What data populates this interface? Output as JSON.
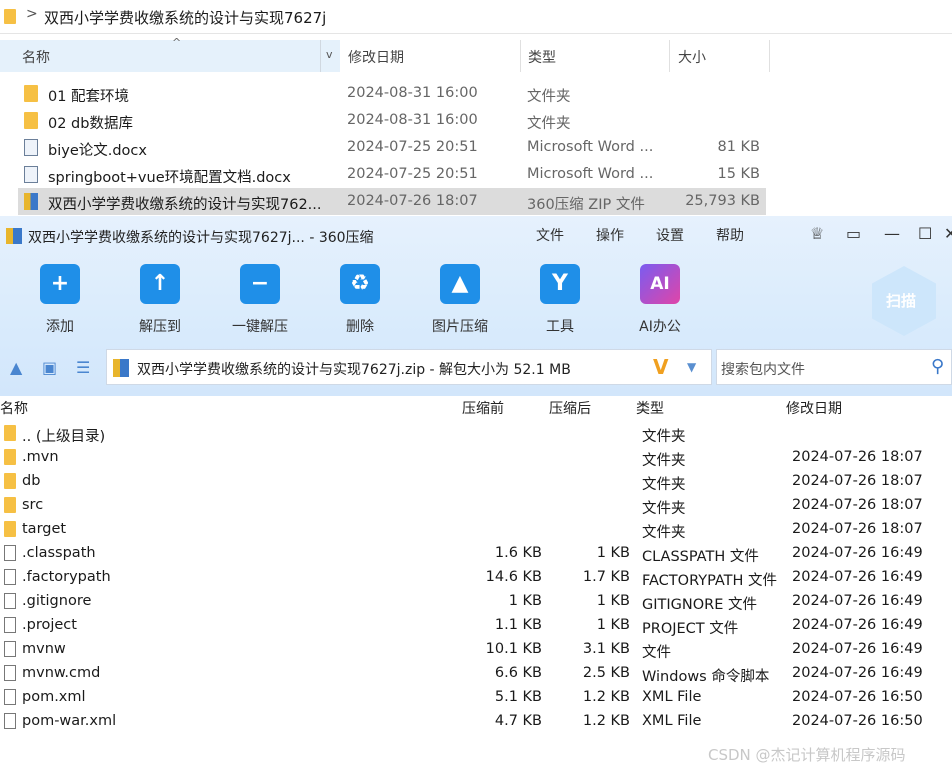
{
  "explorer": {
    "breadcrumb_sep": ">",
    "path": "双西小学学费收缴系统的设计与实现7627j",
    "columns": {
      "name": "名称",
      "date": "修改日期",
      "type": "类型",
      "size": "大小"
    },
    "rows": [
      {
        "name": "01 配套环境",
        "date": "2024-08-31 16:00",
        "type": "文件夹",
        "size": "",
        "icon": "folder-icon"
      },
      {
        "name": "02 db数据库",
        "date": "2024-08-31 16:00",
        "type": "文件夹",
        "size": "",
        "icon": "folder-icon"
      },
      {
        "name": "biye论文.docx",
        "date": "2024-07-25 20:51",
        "type": "Microsoft Word ...",
        "size": "81 KB",
        "icon": "word-doc-icon"
      },
      {
        "name": "springboot+vue环境配置文档.docx",
        "date": "2024-07-25 20:51",
        "type": "Microsoft Word ...",
        "size": "15 KB",
        "icon": "word-doc-icon"
      },
      {
        "name": "双西小学学费收缴系统的设计与实现762...",
        "date": "2024-07-26 18:07",
        "type": "360压缩 ZIP 文件",
        "size": "25,793 KB",
        "icon": "zip-icon",
        "selected": true
      }
    ]
  },
  "zip": {
    "title": "双西小学学费收缴系统的设计与实现7627j... - 360压缩",
    "menu": [
      "文件",
      "操作",
      "设置",
      "帮助"
    ],
    "tools": [
      {
        "label": "添加",
        "icon": "add-icon",
        "glyph": "+"
      },
      {
        "label": "解压到",
        "icon": "extract-to-icon",
        "glyph": "↑"
      },
      {
        "label": "一键解压",
        "icon": "one-click-extract-icon",
        "glyph": "−"
      },
      {
        "label": "删除",
        "icon": "delete-icon",
        "glyph": "♻"
      },
      {
        "label": "图片压缩",
        "icon": "image-compress-icon",
        "glyph": "▲"
      },
      {
        "label": "工具",
        "icon": "tools-icon",
        "glyph": "Y"
      },
      {
        "label": "AI办公",
        "icon": "ai-office-icon",
        "glyph": "AI"
      }
    ],
    "scan_label": "扫描",
    "path_text": "双西小学学费收缴系统的设计与实现7627j.zip - 解包大小为 52.1 MB",
    "search_placeholder": "搜索包内文件",
    "columns": {
      "name": "名称",
      "compressed_before": "压缩前",
      "compressed_after": "压缩后",
      "type": "类型",
      "date": "修改日期"
    },
    "rows": [
      {
        "name": ".. (上级目录)",
        "before": "",
        "after": "",
        "type": "文件夹",
        "date": "",
        "icon": "folder"
      },
      {
        "name": ".mvn",
        "before": "",
        "after": "",
        "type": "文件夹",
        "date": "2024-07-26 18:07",
        "icon": "folder"
      },
      {
        "name": "db",
        "before": "",
        "after": "",
        "type": "文件夹",
        "date": "2024-07-26 18:07",
        "icon": "folder"
      },
      {
        "name": "src",
        "before": "",
        "after": "",
        "type": "文件夹",
        "date": "2024-07-26 18:07",
        "icon": "folder"
      },
      {
        "name": "target",
        "before": "",
        "after": "",
        "type": "文件夹",
        "date": "2024-07-26 18:07",
        "icon": "folder"
      },
      {
        "name": ".classpath",
        "before": "1.6 KB",
        "after": "1 KB",
        "type": "CLASSPATH 文件",
        "date": "2024-07-26 16:49",
        "icon": "file"
      },
      {
        "name": ".factorypath",
        "before": "14.6 KB",
        "after": "1.7 KB",
        "type": "FACTORYPATH 文件",
        "date": "2024-07-26 16:49",
        "icon": "file"
      },
      {
        "name": ".gitignore",
        "before": "1 KB",
        "after": "1 KB",
        "type": "GITIGNORE 文件",
        "date": "2024-07-26 16:49",
        "icon": "file"
      },
      {
        "name": ".project",
        "before": "1.1 KB",
        "after": "1 KB",
        "type": "PROJECT 文件",
        "date": "2024-07-26 16:49",
        "icon": "file"
      },
      {
        "name": "mvnw",
        "before": "10.1 KB",
        "after": "3.1 KB",
        "type": "文件",
        "date": "2024-07-26 16:49",
        "icon": "file"
      },
      {
        "name": "mvnw.cmd",
        "before": "6.6 KB",
        "after": "2.5 KB",
        "type": "Windows 命令脚本",
        "date": "2024-07-26 16:49",
        "icon": "file"
      },
      {
        "name": "pom.xml",
        "before": "5.1 KB",
        "after": "1.2 KB",
        "type": "XML File",
        "date": "2024-07-26 16:50",
        "icon": "file"
      },
      {
        "name": "pom-war.xml",
        "before": "4.7 KB",
        "after": "1.2 KB",
        "type": "XML File",
        "date": "2024-07-26 16:50",
        "icon": "file"
      }
    ]
  },
  "watermark": "CSDN @杰记计算机程序源码"
}
